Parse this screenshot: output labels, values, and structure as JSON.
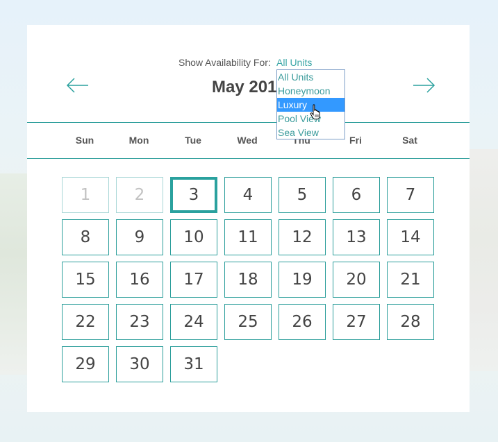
{
  "availability": {
    "label": "Show Availability For:",
    "selected": "All Units",
    "options": [
      "All Units",
      "Honeymoon",
      "Luxury",
      "Pool View",
      "Sea View"
    ],
    "highlighted_option": "Luxury"
  },
  "calendar": {
    "month_title": "May 201",
    "prev_icon": "arrow-left-icon",
    "next_icon": "arrow-right-icon",
    "weekdays": [
      "Sun",
      "Mon",
      "Tue",
      "Wed",
      "Thu",
      "Fri",
      "Sat"
    ],
    "today": "3",
    "past_days": [
      "1",
      "2"
    ],
    "weeks": [
      [
        "1",
        "2",
        "3",
        "4",
        "5",
        "6",
        "7"
      ],
      [
        "8",
        "9",
        "10",
        "11",
        "12",
        "13",
        "14"
      ],
      [
        "15",
        "16",
        "17",
        "18",
        "19",
        "20",
        "21"
      ],
      [
        "22",
        "23",
        "24",
        "25",
        "26",
        "27",
        "28"
      ],
      [
        "29",
        "30",
        "31"
      ]
    ]
  },
  "colors": {
    "accent": "#2a9d9a",
    "link": "#3aa6a6",
    "highlight": "#3399ff",
    "past_border": "#a8d6d6"
  }
}
